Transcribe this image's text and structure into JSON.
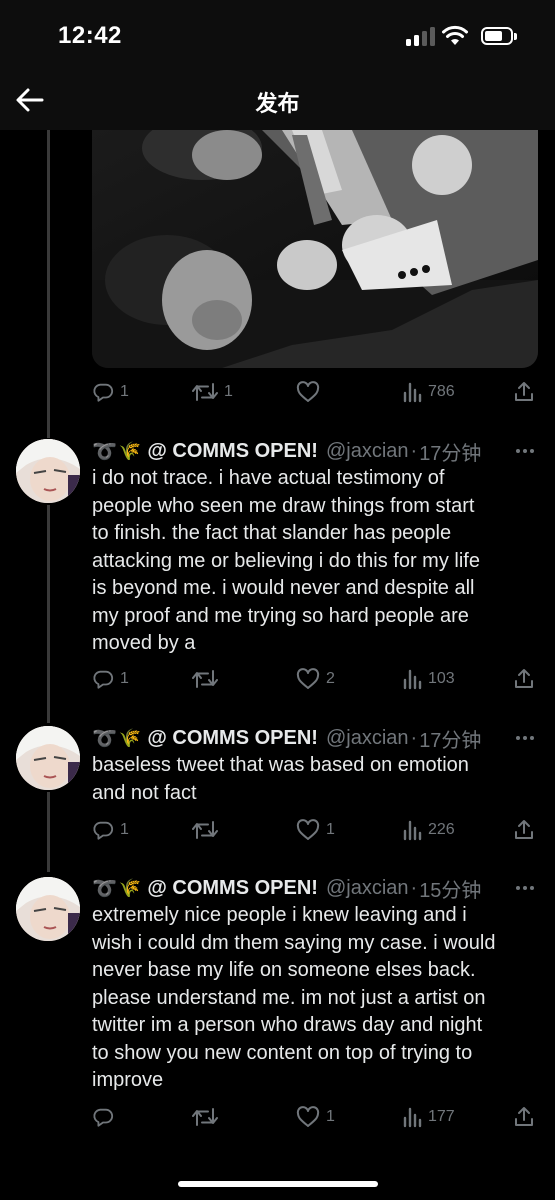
{
  "status_bar": {
    "time": "12:42"
  },
  "header": {
    "title": "发布"
  },
  "media_post": {
    "actions": {
      "replies": "1",
      "retweets": "1",
      "likes": "",
      "views": "786"
    }
  },
  "tweets": [
    {
      "emoji": "➰🌾",
      "display_name": "@ COMMS OPEN!",
      "handle": "@jaxcian",
      "separator": "·",
      "time": "17分钟",
      "lines": [
        "i do not trace. i have actual testimony of",
        "people who seen me draw things from start",
        "to finish. the fact that slander has people",
        "attacking me or believing i do this for my life",
        "is beyond me. i would never and despite all",
        "my proof and me trying so hard people are",
        "moved by a"
      ],
      "actions": {
        "replies": "1",
        "retweets": "",
        "likes": "2",
        "views": "103"
      }
    },
    {
      "emoji": "➰🌾",
      "display_name": "@ COMMS OPEN!",
      "handle": "@jaxcian",
      "separator": "·",
      "time": "17分钟",
      "lines": [
        "baseless tweet that was based on emotion",
        "and not fact"
      ],
      "actions": {
        "replies": "1",
        "retweets": "",
        "likes": "1",
        "views": "226"
      }
    },
    {
      "emoji": "➰🌾",
      "display_name": "@ COMMS OPEN!",
      "handle": "@jaxcian",
      "separator": "·",
      "time": "15分钟",
      "lines": [
        "extremely nice people i knew leaving and i",
        "wish i could dm them saying my case. i would",
        "never base my life on someone elses back.",
        "please understand me. im not just a artist on",
        "twitter im a person who draws day and night",
        "to show you new content on top of trying to",
        "improve"
      ],
      "actions": {
        "replies": "",
        "retweets": "",
        "likes": "1",
        "views": "177"
      }
    }
  ],
  "colors": {
    "background": "#000000",
    "text": "#e7e9ea",
    "muted": "#71767b",
    "thread_line": "#3a3a3a"
  },
  "icons": [
    "back-arrow-icon",
    "signal-icon",
    "wifi-icon",
    "battery-icon",
    "reply-icon",
    "retweet-icon",
    "like-icon",
    "views-icon",
    "share-icon",
    "more-icon"
  ]
}
